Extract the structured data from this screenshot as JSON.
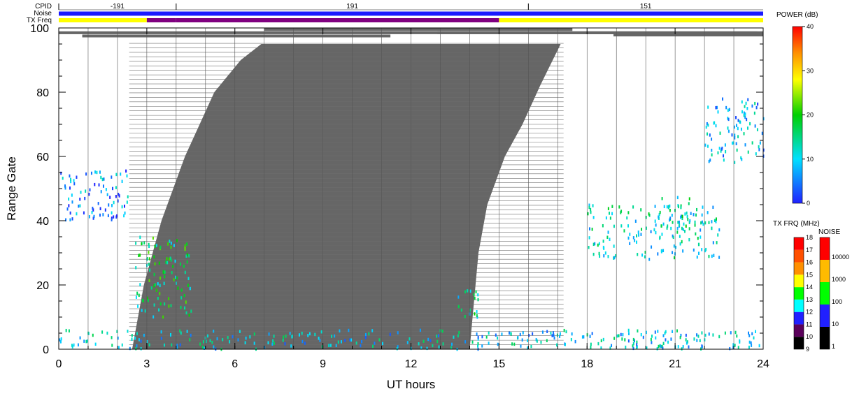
{
  "chart_data": {
    "type": "heatmap",
    "xlabel": "UT hours",
    "ylabel": "Range Gate",
    "xlim": [
      0,
      24
    ],
    "ylim": [
      0,
      100
    ],
    "x_ticks": [
      "0",
      "3",
      "6",
      "9",
      "12",
      "15",
      "18",
      "21",
      "24"
    ],
    "y_ticks": [
      "0",
      "20",
      "40",
      "60",
      "80",
      "100"
    ],
    "grid": "vertical lines every hour",
    "header": {
      "cpid_label": "CPID",
      "noise_label": "Noise",
      "txfreq_label": "TX Freq",
      "cpid_segments": [
        {
          "start": 0,
          "end": 4,
          "label": "-191"
        },
        {
          "start": 4,
          "end": 16,
          "label": "191"
        },
        {
          "start": 16,
          "end": 24,
          "label": "151"
        }
      ],
      "noise_color": "#1a1aff",
      "txfreq_segments": [
        {
          "start": 0,
          "end": 3,
          "color": "#ffff00"
        },
        {
          "start": 3,
          "end": 4,
          "color": "#800080"
        },
        {
          "start": 4,
          "end": 15,
          "color": "#800080"
        },
        {
          "start": 15,
          "end": 24,
          "color": "#ffff00"
        }
      ]
    },
    "ground_scatter_color": "#666666",
    "ground_scatter_boundary": [
      [
        2.5,
        0
      ],
      [
        2.9,
        20
      ],
      [
        3.5,
        40
      ],
      [
        4.3,
        60
      ],
      [
        5.3,
        80
      ],
      [
        6.2,
        90
      ],
      [
        6.9,
        95
      ],
      [
        17.1,
        95
      ],
      [
        16.4,
        82
      ],
      [
        15.8,
        70
      ],
      [
        15.2,
        60
      ],
      [
        14.6,
        45
      ],
      [
        14.3,
        30
      ],
      [
        14.2,
        20
      ],
      [
        14.1,
        10
      ],
      [
        14.0,
        0
      ]
    ],
    "top_bands": [
      {
        "start": 0.0,
        "end": 24.0,
        "gate": 98.5
      },
      {
        "start": 0.8,
        "end": 11.3,
        "gate": 97.5
      },
      {
        "start": 7.0,
        "end": 17.5,
        "gate": 99.5
      },
      {
        "start": 12.9,
        "end": 23.8,
        "gate": 98.5
      },
      {
        "start": 18.9,
        "end": 24.0,
        "gate": 97.8
      }
    ],
    "power_colorbar": {
      "title": "POWER (dB)",
      "min": 0,
      "max": 40,
      "ticks": [
        "0",
        "10",
        "20",
        "30",
        "40"
      ]
    },
    "txfreq_colorbar": {
      "title": "TX FRQ (MHz)",
      "ticks": [
        "9",
        "10",
        "11",
        "12",
        "13",
        "14",
        "15",
        "16",
        "17",
        "18"
      ]
    },
    "noise_colorbar": {
      "title": "NOISE",
      "ticks": [
        "1",
        "10",
        "100",
        "1000",
        "10000"
      ]
    },
    "echo_regions": [
      {
        "x": [
          2.6,
          4.5
        ],
        "gates": [
          10,
          35
        ],
        "power_db": 16
      },
      {
        "x": [
          13.5,
          14.3
        ],
        "gates": [
          10,
          20
        ],
        "power_db": 14
      },
      {
        "x": [
          18.0,
          22.5
        ],
        "gates": [
          28,
          45
        ],
        "power_db": 12
      },
      {
        "x": [
          20.5,
          21.5
        ],
        "gates": [
          38,
          48
        ],
        "power_db": 15
      },
      {
        "x": [
          0,
          24
        ],
        "gates": [
          0,
          6
        ],
        "power_db": 10
      },
      {
        "x": [
          0,
          2.4
        ],
        "gates": [
          40,
          56
        ],
        "power_db": 6
      },
      {
        "x": [
          22.0,
          24.0
        ],
        "gates": [
          58,
          78
        ],
        "power_db": 8
      }
    ]
  }
}
